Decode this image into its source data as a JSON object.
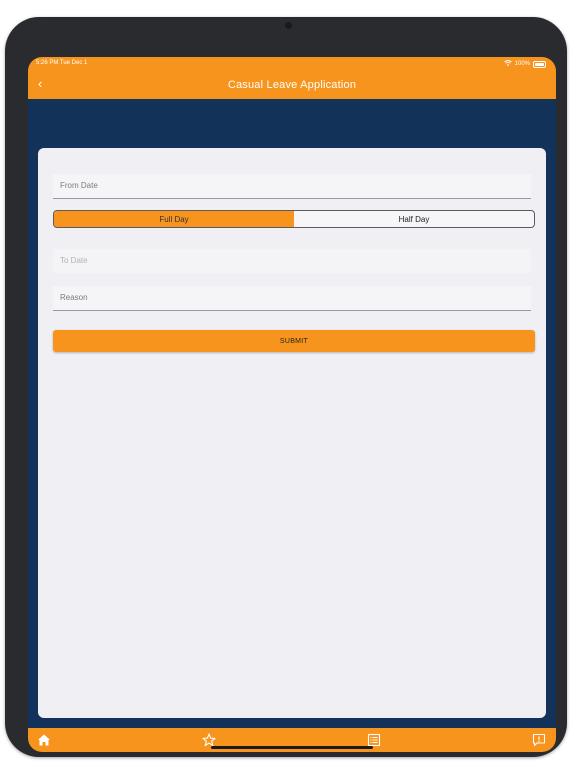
{
  "status_bar": {
    "time": "5:26 PM  Tue Dec 1",
    "battery": "100%"
  },
  "nav": {
    "title": "Casual Leave Application"
  },
  "form": {
    "from_date_placeholder": "From Date",
    "segment": {
      "options": [
        "Full Day",
        "Half Day"
      ],
      "selected": "Full Day"
    },
    "to_date_placeholder": "To Date",
    "reason_placeholder": "Reason",
    "submit_label": "SUBMIT"
  },
  "tabs": [
    {
      "icon": "home-icon"
    },
    {
      "icon": "star-icon"
    },
    {
      "icon": "list-icon"
    },
    {
      "icon": "feedback-icon"
    }
  ],
  "colors": {
    "accent": "#f7941d",
    "header_band": "#12325a",
    "card": "#f0f0f4"
  }
}
